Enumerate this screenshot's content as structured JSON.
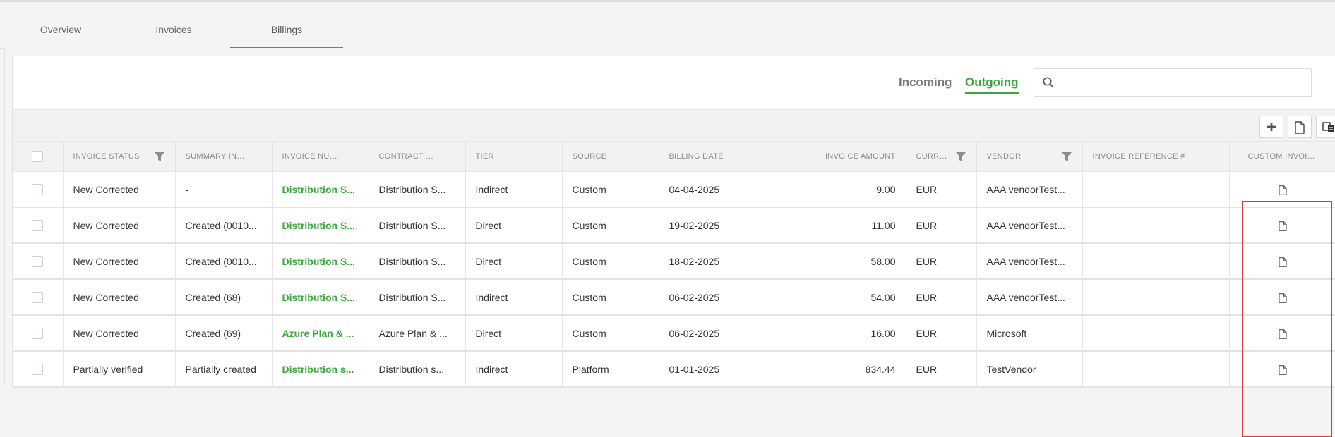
{
  "tabs": [
    {
      "label": "Overview"
    },
    {
      "label": "Invoices"
    },
    {
      "label": "Billings"
    }
  ],
  "segments": {
    "incoming": "Incoming",
    "outgoing": "Outgoing"
  },
  "search": {
    "placeholder": "",
    "value": ""
  },
  "colors": {
    "accent": "#3aa63e",
    "highlight": "#d63b3b"
  },
  "toolbar_icons": [
    "plus-icon",
    "document-icon",
    "export-icon"
  ],
  "table": {
    "columns": [
      "Invoice Status",
      "Summary Invoi...",
      "Invoice Number",
      "Contract Type",
      "Tier",
      "Source",
      "Billing Date",
      "Invoice Amount",
      "Curre...",
      "Vendor",
      "Invoice Reference #",
      "Custom Invoice"
    ],
    "rows": [
      {
        "status": "New Corrected",
        "summary": "-",
        "number": "Distribution S...",
        "contract": "Distribution S...",
        "tier": "Indirect",
        "source": "Custom",
        "date": "04-04-2025",
        "amount": "9.00",
        "currency": "EUR",
        "vendor": "AAA vendorTest...",
        "reference": ""
      },
      {
        "status": "New Corrected",
        "summary": "Created (0010...",
        "number": "Distribution S...",
        "contract": "Distribution S...",
        "tier": "Direct",
        "source": "Custom",
        "date": "19-02-2025",
        "amount": "11.00",
        "currency": "EUR",
        "vendor": "AAA vendorTest...",
        "reference": ""
      },
      {
        "status": "New Corrected",
        "summary": "Created (0010...",
        "number": "Distribution S...",
        "contract": "Distribution S...",
        "tier": "Direct",
        "source": "Custom",
        "date": "18-02-2025",
        "amount": "58.00",
        "currency": "EUR",
        "vendor": "AAA vendorTest...",
        "reference": ""
      },
      {
        "status": "New Corrected",
        "summary": "Created (68)",
        "number": "Distribution S...",
        "contract": "Distribution S...",
        "tier": "Indirect",
        "source": "Custom",
        "date": "06-02-2025",
        "amount": "54.00",
        "currency": "EUR",
        "vendor": "AAA vendorTest...",
        "reference": ""
      },
      {
        "status": "New Corrected",
        "summary": "Created (69)",
        "number": "Azure Plan & ...",
        "contract": "Azure Plan & ...",
        "tier": "Direct",
        "source": "Custom",
        "date": "06-02-2025",
        "amount": "16.00",
        "currency": "EUR",
        "vendor": "Microsoft",
        "reference": ""
      },
      {
        "status": "Partially verified",
        "summary": "Partially created",
        "number": "Distribution s...",
        "contract": "Distribution s...",
        "tier": "Indirect",
        "source": "Platform",
        "date": "01-01-2025",
        "amount": "834.44",
        "currency": "EUR",
        "vendor": "TestVendor",
        "reference": ""
      }
    ]
  }
}
